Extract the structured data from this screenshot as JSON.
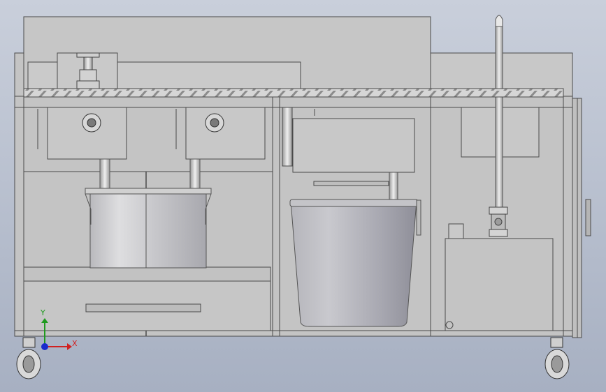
{
  "viewport": {
    "background_top": "#c9cfdb",
    "background_bottom": "#a7b0c2"
  },
  "model": {
    "name": "stainless-steel-kitchen-cart",
    "steel_color": "#c8c8c8",
    "edge_color": "#4a4a4a"
  },
  "triad": {
    "x_label": "X",
    "y_label": "Y",
    "x_color": "#d12020",
    "y_color": "#1f9a1f",
    "z_color": "#1a2ccc"
  }
}
